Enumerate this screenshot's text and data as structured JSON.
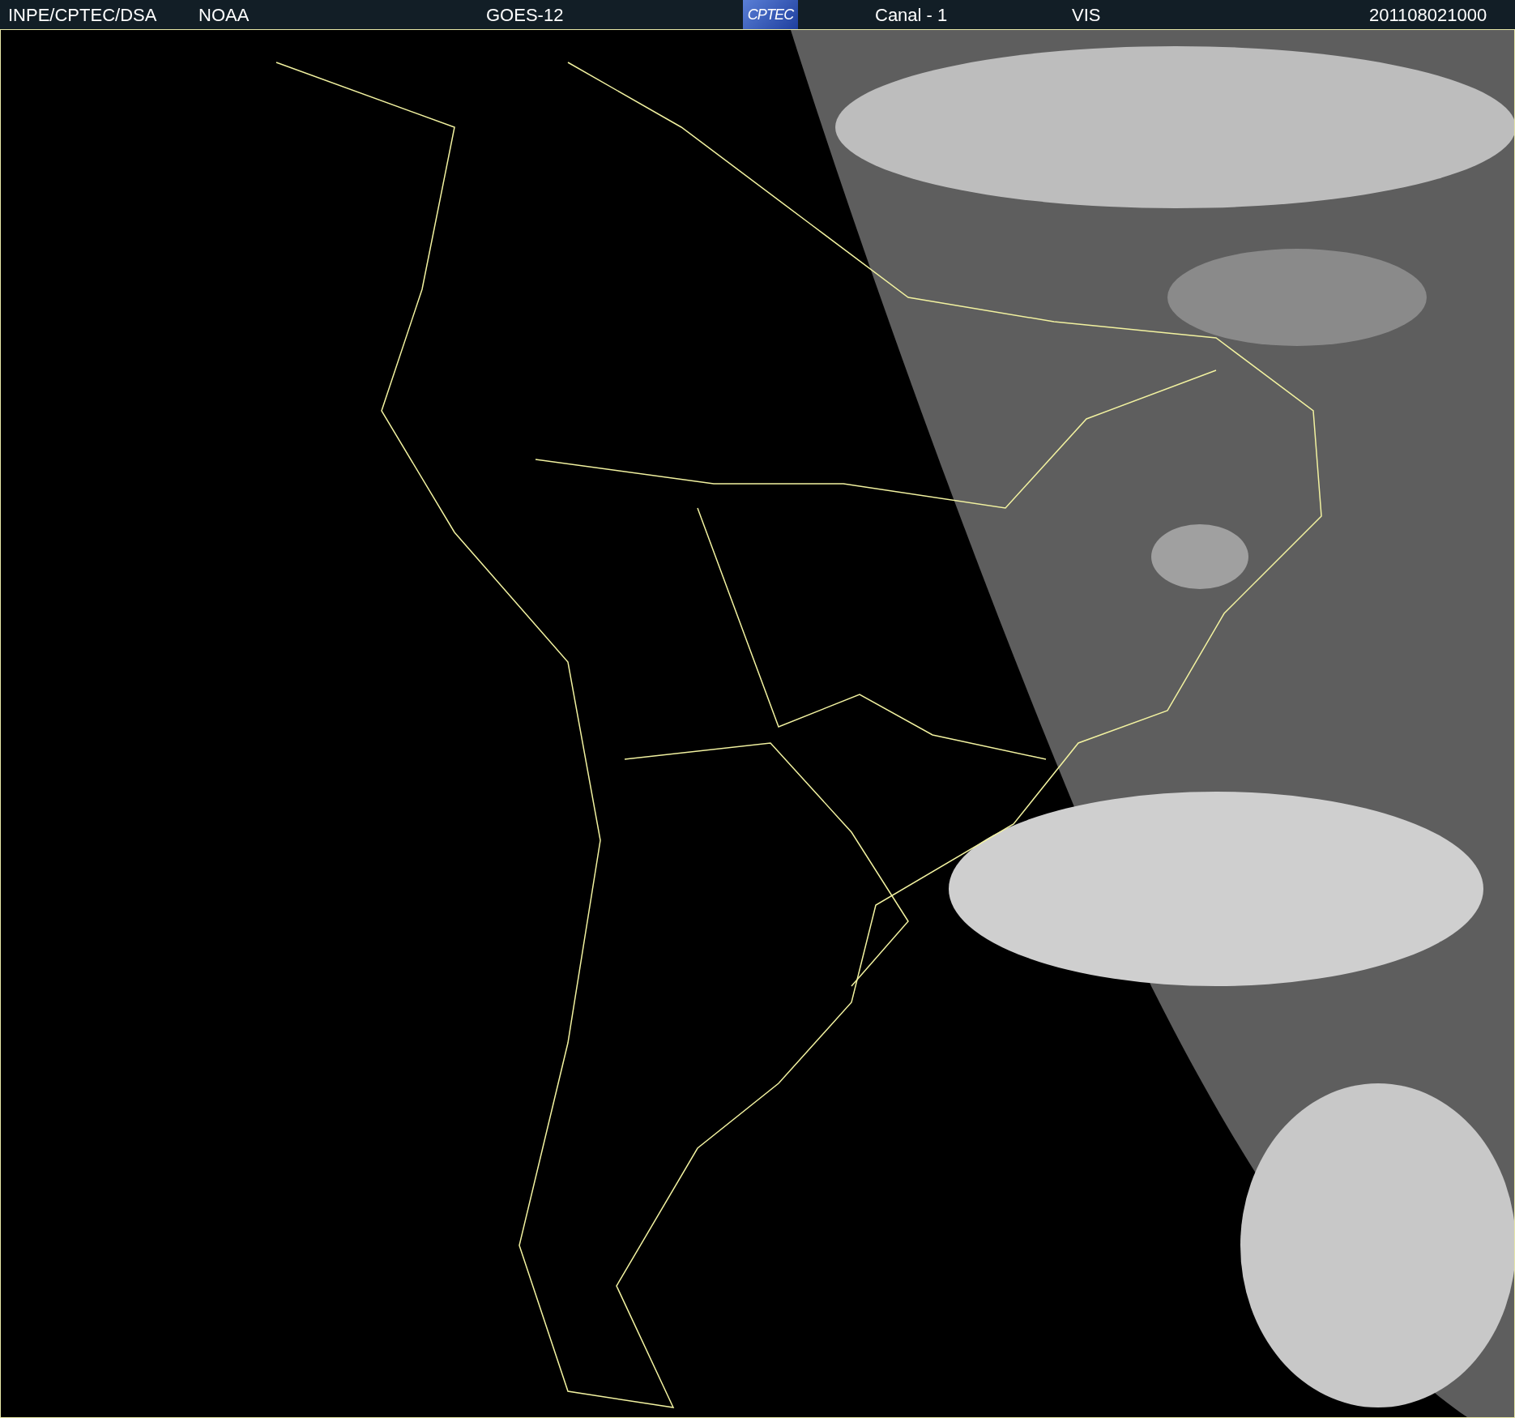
{
  "header": {
    "agency": "INPE/CPTEC/DSA",
    "source": "NOAA",
    "satellite": "GOES-12",
    "logo": "CPTEC",
    "channel": "Canal - 1",
    "band": "VIS",
    "timestamp": "201108021000"
  }
}
